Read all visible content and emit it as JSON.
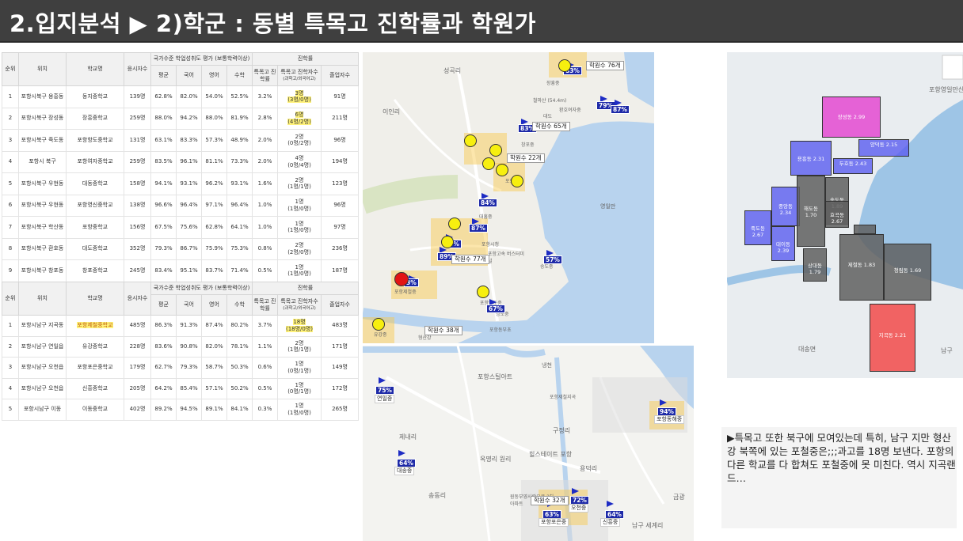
{
  "title": "2.입지분석 ▶ 2)학군 : 동별 특목고 진학률과 학원가",
  "table_headers": {
    "rank": "순위",
    "location": "위치",
    "school": "학교명",
    "examinees": "응시자수",
    "eval_group": "국가수준 학업성취도 평가 (보통학력이상)",
    "avg": "평균",
    "kor": "국어",
    "eng": "영어",
    "math": "수학",
    "adv_group": "진학률",
    "spec_rate": "특목고 진학률",
    "spec_count": "특목고 진학자수",
    "spec_sub": "(과학고/외국어고)",
    "grads": "졸업자수"
  },
  "north_rows": [
    {
      "rank": "1",
      "loc": "포항시북구 용흥동",
      "school": "동지중학교",
      "exam": "139명",
      "avg": "62.8%",
      "kor": "82.0%",
      "eng": "54.0%",
      "math": "52.5%",
      "rate": "3.2%",
      "cnt": "3명\n(3명/0명)",
      "grad": "91명",
      "hl": true
    },
    {
      "rank": "2",
      "loc": "포항시북구 장성동",
      "school": "장흥중학교",
      "exam": "259명",
      "avg": "88.0%",
      "kor": "94.2%",
      "eng": "88.0%",
      "math": "81.9%",
      "rate": "2.8%",
      "cnt": "6명\n(4명/2명)",
      "grad": "211명",
      "hl": true
    },
    {
      "rank": "3",
      "loc": "포항시북구 죽도동",
      "school": "포항항도중학교",
      "exam": "131명",
      "avg": "63.1%",
      "kor": "83.3%",
      "eng": "57.3%",
      "math": "48.9%",
      "rate": "2.0%",
      "cnt": "2명\n(0명/2명)",
      "grad": "96명",
      "hl": false
    },
    {
      "rank": "4",
      "loc": "포항시 북구",
      "school": "포항여자중학교",
      "exam": "259명",
      "avg": "83.5%",
      "kor": "96.1%",
      "eng": "81.1%",
      "math": "73.3%",
      "rate": "2.0%",
      "cnt": "4명\n(0명/4명)",
      "grad": "194명",
      "hl": false
    },
    {
      "rank": "5",
      "loc": "포항시북구 우현동",
      "school": "대동중학교",
      "exam": "158명",
      "avg": "94.1%",
      "kor": "93.1%",
      "eng": "96.2%",
      "math": "93.1%",
      "rate": "1.6%",
      "cnt": "2명\n(1명/1명)",
      "grad": "123명",
      "hl": false
    },
    {
      "rank": "6",
      "loc": "포항시북구 우현동",
      "school": "포항영신중학교",
      "exam": "138명",
      "avg": "96.6%",
      "kor": "96.4%",
      "eng": "97.1%",
      "math": "96.4%",
      "rate": "1.0%",
      "cnt": "1명\n(1명/0명)",
      "grad": "96명",
      "hl": false
    },
    {
      "rank": "7",
      "loc": "포항시북구 학산동",
      "school": "포항중학교",
      "exam": "156명",
      "avg": "67.5%",
      "kor": "75.6%",
      "eng": "62.8%",
      "math": "64.1%",
      "rate": "1.0%",
      "cnt": "1명\n(1명/0명)",
      "grad": "97명",
      "hl": false
    },
    {
      "rank": "8",
      "loc": "포항시북구 환호동",
      "school": "대도중학교",
      "exam": "352명",
      "avg": "79.3%",
      "kor": "86.7%",
      "eng": "75.9%",
      "math": "75.3%",
      "rate": "0.8%",
      "cnt": "2명\n(2명/0명)",
      "grad": "236명",
      "hl": false
    },
    {
      "rank": "9",
      "loc": "포항시북구 창포동",
      "school": "창포중학교",
      "exam": "245명",
      "avg": "83.4%",
      "kor": "95.1%",
      "eng": "83.7%",
      "math": "71.4%",
      "rate": "0.5%",
      "cnt": "1명\n(1명/0명)",
      "grad": "187명",
      "hl": false
    }
  ],
  "south_rows": [
    {
      "rank": "1",
      "loc": "포항시남구 지곡동",
      "school": "포항제철중학교",
      "exam": "485명",
      "avg": "86.3%",
      "kor": "91.3%",
      "eng": "87.4%",
      "math": "80.2%",
      "rate": "3.7%",
      "cnt": "18명\n(18명/0명)",
      "grad": "483명",
      "hl": true
    },
    {
      "rank": "2",
      "loc": "포항시남구 연일읍",
      "school": "유강중학교",
      "exam": "228명",
      "avg": "83.6%",
      "kor": "90.8%",
      "eng": "82.0%",
      "math": "78.1%",
      "rate": "1.1%",
      "cnt": "2명\n(1명/1명)",
      "grad": "171명",
      "hl": false
    },
    {
      "rank": "3",
      "loc": "포항시남구 오천읍",
      "school": "포항포은중학교",
      "exam": "179명",
      "avg": "62.7%",
      "kor": "79.3%",
      "eng": "58.7%",
      "math": "50.3%",
      "rate": "0.6%",
      "cnt": "1명\n(0명/1명)",
      "grad": "149명",
      "hl": false
    },
    {
      "rank": "4",
      "loc": "포항시남구 오천읍",
      "school": "신흥중학교",
      "exam": "205명",
      "avg": "64.2%",
      "kor": "85.4%",
      "eng": "57.1%",
      "math": "50.2%",
      "rate": "0.5%",
      "cnt": "1명\n(0명/1명)",
      "grad": "172명",
      "hl": false
    },
    {
      "rank": "5",
      "loc": "포항시남구 이동",
      "school": "이동중학교",
      "exam": "402명",
      "avg": "89.2%",
      "kor": "94.5%",
      "eng": "89.1%",
      "math": "84.1%",
      "rate": "0.3%",
      "cnt": "1명\n(1명/0명)",
      "grad": "265명",
      "hl": false
    }
  ],
  "map_north": {
    "places": [
      "성곡리",
      "이인리",
      "포항시청",
      "환호여자중",
      "장흥중",
      "철마산 (54.4m)",
      "대도",
      "창포중",
      "포항중",
      "대흥중",
      "포항고속 버스터미널",
      "송도중",
      "포항제철중",
      "포항항도중",
      "상도중",
      "유강중",
      "형산강",
      "포항동부초",
      "영일만"
    ],
    "schools": [
      {
        "pct": "83%",
        "name": "장흥중"
      },
      {
        "pct": "79%",
        "name": "대도"
      },
      {
        "pct": "87%",
        "name": "환호여자중"
      },
      {
        "pct": "83%",
        "name": "창포중"
      },
      {
        "pct": "84%",
        "name": "대흥중"
      },
      {
        "pct": "78%",
        "name": "동지중"
      },
      {
        "pct": "87%",
        "name": "동호중"
      },
      {
        "pct": "89%",
        "name": "이동중"
      },
      {
        "pct": "57%",
        "name": "송도중"
      },
      {
        "pct": "67%",
        "name": "상도중"
      },
      {
        "pct": "3%",
        "name": "포항제철중"
      }
    ],
    "academies": [
      "학원수 76개",
      "학원수 65개",
      "학원수 22개",
      "학원수 77개",
      "학원수 38개"
    ]
  },
  "map_south": {
    "places": [
      "포항스틸아트",
      "제내리",
      "구정리",
      "옥명리 원리",
      "힐스테이트 포항",
      "송동리",
      "용덕리",
      "금광",
      "원동부영사랑으로 2차아파트",
      "남구 세계리",
      "냉천",
      "포항제철지곡"
    ],
    "schools": [
      {
        "pct": "75%",
        "name": "연일중"
      },
      {
        "pct": "94%",
        "name": "포항동해중"
      },
      {
        "pct": "64%",
        "name": "대송중"
      },
      {
        "pct": "63%",
        "name": "포항포은중"
      },
      {
        "pct": "72%",
        "name": "오천중"
      },
      {
        "pct": "64%",
        "name": "신흥중"
      }
    ],
    "academies": [
      "학원수 32개"
    ]
  },
  "map_right": {
    "zones": [
      {
        "label": "장성동\n2.99"
      },
      {
        "label": "양덕동\n2.15"
      },
      {
        "label": "용흥동\n2.31"
      },
      {
        "label": "두호동\n2.43"
      },
      {
        "label": "중앙동\n2.34"
      },
      {
        "label": "죽도동\n2.67"
      },
      {
        "label": "대이동\n2.39"
      },
      {
        "label": "해도동\n1.70"
      },
      {
        "label": "송도동\n1.89"
      },
      {
        "label": "상대동\n1.79"
      },
      {
        "label": "제철동\n1.83"
      },
      {
        "label": "청림동\n1.69"
      },
      {
        "label": "효곡동\n2.67"
      },
      {
        "label": "지곡동\n2.21"
      }
    ],
    "places": [
      "포항영일만신항",
      "남구",
      "대송면"
    ],
    "colors": {
      "pink": "#e33fd0",
      "blue": "#5a5cf0",
      "gray": "#5f5f5f",
      "red": "#f24a4a"
    }
  },
  "comment": "▶특목고 또한 북구에 모여있는데 특히, 남구 지만 형산강 북쪽에 있는 포철중은;;;과고를 18명 보낸다. 포항의 다른 학교를 다 합쳐도 포철중에 못 미친다. 역시 지곡랜드…"
}
